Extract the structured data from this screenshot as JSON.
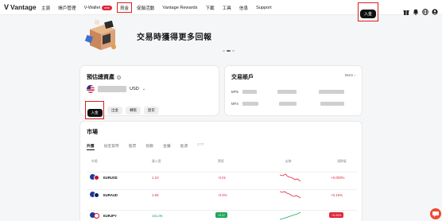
{
  "brand": {
    "name": "Vantage",
    "mark": "V"
  },
  "nav": {
    "items": [
      {
        "label": "主頁",
        "id": "home"
      },
      {
        "label": "帳戶管理",
        "id": "account"
      },
      {
        "label": "V-Wallet",
        "id": "vwallet",
        "badge": "new"
      },
      {
        "label": "資金",
        "id": "funds",
        "highlighted": true
      },
      {
        "label": "促銷活動",
        "id": "promotions"
      },
      {
        "label": "Vantage Rewards",
        "id": "rewards"
      },
      {
        "label": "下載",
        "id": "download"
      },
      {
        "label": "工具",
        "id": "tools"
      },
      {
        "label": "信息",
        "id": "info"
      },
      {
        "label": "Support",
        "id": "support"
      }
    ],
    "deposit_label": "入金",
    "right_icons": [
      "gift-icon",
      "bell-icon",
      "globe-icon",
      "user-icon"
    ]
  },
  "banner": {
    "text": "交易時獲得更多回報",
    "dot_count": 3,
    "active_dot": 1
  },
  "assets": {
    "title": "預估總資產",
    "currency": "USD",
    "buttons": [
      {
        "label": "入金",
        "style": "dark",
        "highlighted": true
      },
      {
        "label": "出金",
        "style": "light"
      },
      {
        "label": "轉帳",
        "style": "light"
      },
      {
        "label": "歷史",
        "style": "light"
      }
    ]
  },
  "accounts": {
    "title": "交易賬戶",
    "more_label": "More",
    "rows": [
      {
        "platform": "MT5"
      },
      {
        "platform": "MT4"
      }
    ]
  },
  "market": {
    "title": "市場",
    "tabs": [
      {
        "label": "外匯",
        "active": true
      },
      {
        "label": "加密貨幣"
      },
      {
        "label": "股票"
      },
      {
        "label": "指數"
      },
      {
        "label": "金屬"
      },
      {
        "label": "能源"
      },
      {
        "label": "ETF",
        "dim": true
      }
    ],
    "columns": [
      "市場",
      "買入價",
      "賣價",
      "走勢",
      "漲跌幅"
    ],
    "rows": [
      {
        "pair": "EURUSD",
        "bid": "1.10",
        "change": "-0.01",
        "trend": "down",
        "pct": "+0.003%",
        "color_a": "#1f3a93",
        "color_b": "#c8102e"
      },
      {
        "pair": "EURAUD",
        "bid": "1.65",
        "change": "-0.0%",
        "trend": "down",
        "pct": "+0.16%",
        "color_a": "#1f3a93",
        "color_b": "#012169"
      },
      {
        "pair": "EURJPY",
        "bid": "161.06",
        "change": "+0.37",
        "trend": "up",
        "pct": "+0.25%",
        "color_a": "#1f3a93",
        "color_b": "#ffffff"
      }
    ]
  },
  "colors": {
    "accent_red": "#e0263a",
    "accent_green": "#1fa85a",
    "highlight": "#d91e1e",
    "dark": "#111111"
  }
}
